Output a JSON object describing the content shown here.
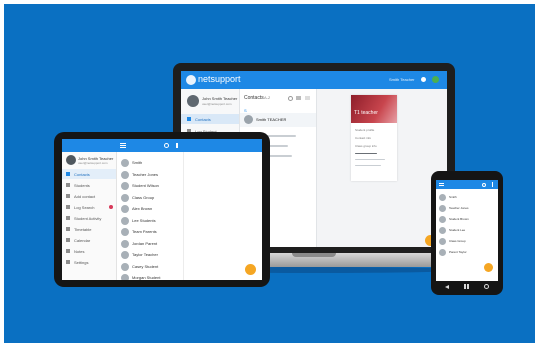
{
  "laptop": {
    "brand": "netsupport",
    "user_name": "John Smith Teacher",
    "user_sub": "user@netsupport.com",
    "header_right": "Smith Teacher",
    "menu_active": "Contacts",
    "menu_second": "Log Student",
    "list_title": "Contacts",
    "list_sort": "A-Z",
    "selected_contact": "Smith TEACHER",
    "detail_badge": "T1 teacher",
    "detail_lines": [
      "Student profile",
      "Contact info",
      "Class group info"
    ]
  },
  "tablet": {
    "user_name": "John Smith Teacher",
    "user_sub": "user@netsupport.com",
    "menu": [
      "Contacts",
      "Students",
      "Add contact",
      "Log Search",
      "Student Activity",
      "Timetable",
      "Calendar",
      "Notes",
      "Settings"
    ],
    "contacts": [
      "Smith",
      "Teacher Jones",
      "Student Wilson",
      "Class Group",
      "Alex Brown",
      "Lee Students",
      "Team Parents",
      "Jordan Parent",
      "Taylor Teacher",
      "Casey Student",
      "Morgan Student"
    ],
    "fab_icon": "plus"
  },
  "phone": {
    "contacts": [
      "Smith",
      "Teacher Jones",
      "Student Brown",
      "Student Lee",
      "Class Group",
      "Parent Taylor"
    ],
    "fab_icon": "plus",
    "nav_icons": [
      "back-icon",
      "windows-icon",
      "search-icon"
    ]
  },
  "colors": {
    "background": "#0a70c2",
    "app_bar": "#1e88e5",
    "accent": "#f5a623",
    "badge": "#b22b35"
  }
}
